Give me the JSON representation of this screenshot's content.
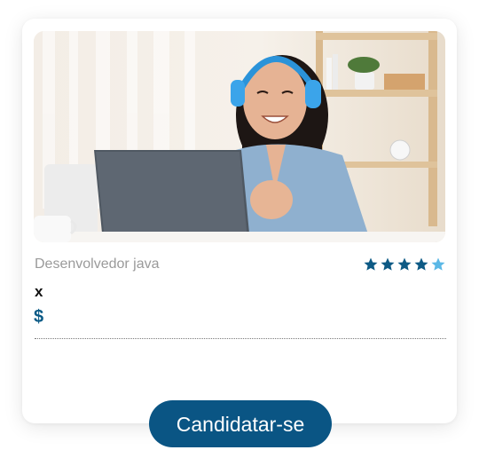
{
  "job_card": {
    "title": "Desenvolvedor java",
    "subtitle": "x",
    "price_symbol": "$",
    "rating": {
      "value": 4,
      "max": 5
    },
    "apply_label": "Candidatar-se",
    "image_icon": "woman-with-headphones-at-laptop-photo"
  },
  "colors": {
    "accent": "#0a5584",
    "star_filled": "#0d5a85",
    "star_empty": "#5bb8e6",
    "muted_text": "#9a9a9a"
  }
}
